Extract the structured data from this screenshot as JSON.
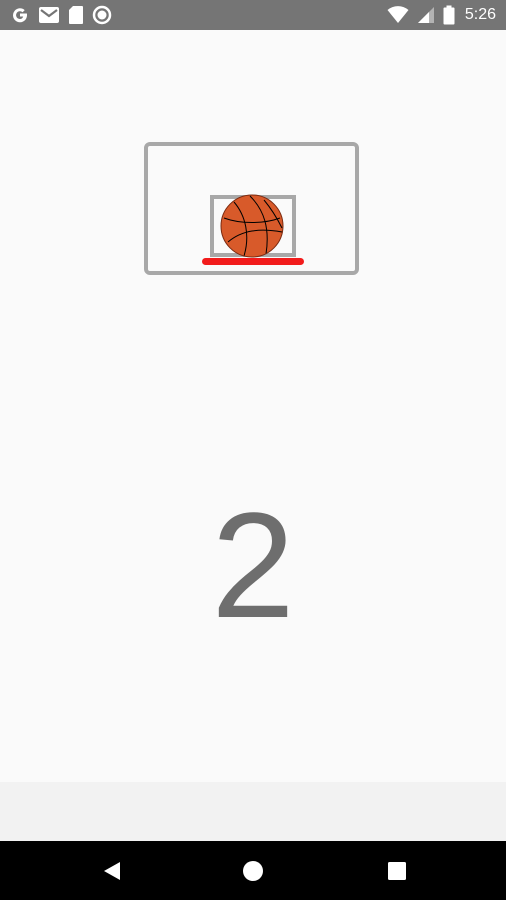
{
  "status_bar": {
    "time": "5:26",
    "left_icons": [
      "google-icon",
      "gmail-icon",
      "sd-card-icon",
      "circle-record-icon"
    ],
    "right_icons": [
      "wifi-icon",
      "signal-icon",
      "battery-icon"
    ],
    "background": "#757575"
  },
  "game": {
    "score": "2",
    "ball_color": "#d85a2a",
    "rim_color": "#f21b1b",
    "backboard_color": "#a8a8a8"
  },
  "nav_bar": {
    "buttons": [
      "back-icon",
      "home-icon",
      "recents-icon"
    ]
  }
}
